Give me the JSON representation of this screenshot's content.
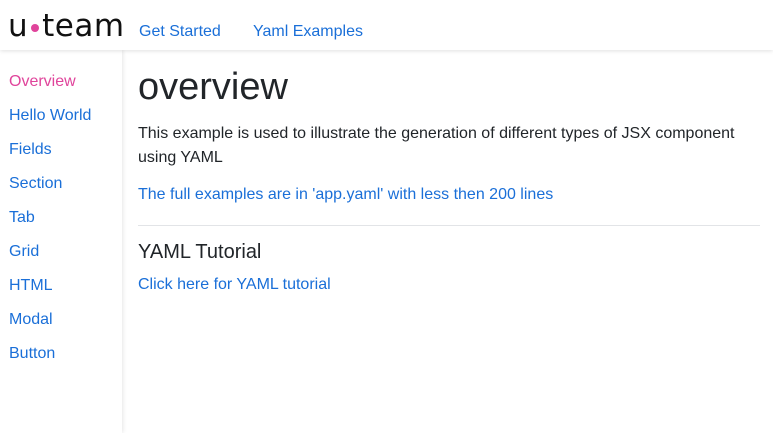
{
  "header": {
    "logo": {
      "left": "u",
      "right": "team",
      "dot_color": "#e0449b"
    },
    "nav": [
      {
        "label": "Get Started"
      },
      {
        "label": "Yaml Examples"
      }
    ]
  },
  "sidebar": {
    "items": [
      {
        "label": "Overview",
        "active": true
      },
      {
        "label": "Hello World"
      },
      {
        "label": "Fields"
      },
      {
        "label": "Section"
      },
      {
        "label": "Tab"
      },
      {
        "label": "Grid"
      },
      {
        "label": "HTML"
      },
      {
        "label": "Modal"
      },
      {
        "label": "Button"
      }
    ]
  },
  "main": {
    "title": "overview",
    "intro": "This example is used to illustrate the generation of different types of JSX component using YAML",
    "full_examples_link": "The full examples are in 'app.yaml' with less then 200 lines",
    "tutorial_heading": "YAML Tutorial",
    "tutorial_link": "Click here for YAML tutorial"
  },
  "colors": {
    "link": "#1a6fd8",
    "active": "#e0449b",
    "text": "#212529",
    "divider": "#e2e4e7"
  }
}
